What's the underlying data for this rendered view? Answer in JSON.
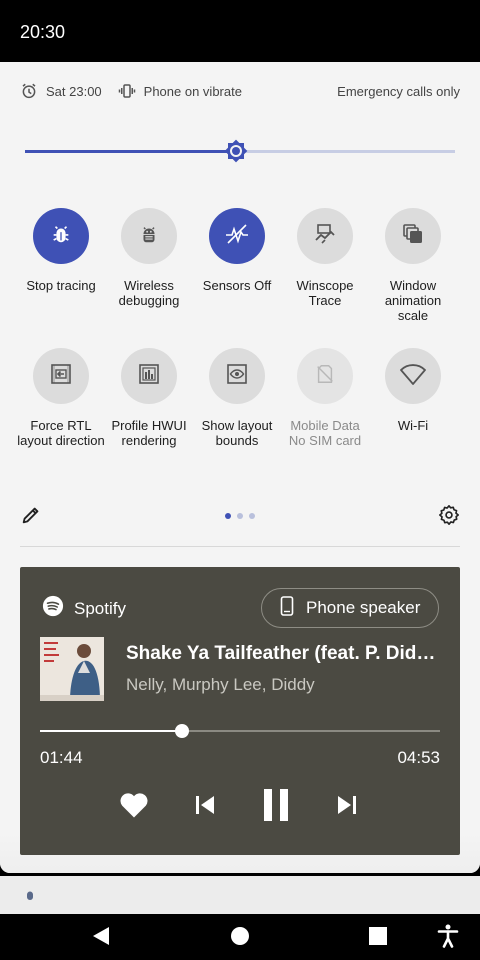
{
  "status_bar": {
    "time": "20:30"
  },
  "header": {
    "alarm_time": "Sat 23:00",
    "ringer_status": "Phone on vibrate",
    "carrier_status": "Emergency calls only"
  },
  "brightness": {
    "level": 0.49
  },
  "tiles": [
    {
      "label": "Stop tracing",
      "state": "on"
    },
    {
      "label": "Wireless\ndebugging",
      "state": "off"
    },
    {
      "label": "Sensors Off",
      "state": "on"
    },
    {
      "label": "Winscope\nTrace",
      "state": "off"
    },
    {
      "label": "Window\nanimation\nscale",
      "state": "off"
    },
    {
      "label": "Force RTL\nlayout direction",
      "state": "off"
    },
    {
      "label": "Profile HWUI\nrendering",
      "state": "off"
    },
    {
      "label": "Show layout\nbounds",
      "state": "off"
    },
    {
      "label": "Mobile Data",
      "secondary": "No SIM card",
      "state": "unavailable"
    },
    {
      "label": "Wi-Fi",
      "state": "off"
    }
  ],
  "pager": {
    "pages": 3,
    "current": 1
  },
  "media": {
    "app_name": "Spotify",
    "output_device": "Phone speaker",
    "title": "Shake Ya Tailfeather (feat. P. Diddy & Murphy Lee)",
    "artist": "Nelly, Murphy Lee, Diddy",
    "elapsed": "01:44",
    "duration": "04:53",
    "progress": 0.355,
    "background_color": "#4b4a42"
  },
  "colors": {
    "accent": "#3f51b5"
  }
}
